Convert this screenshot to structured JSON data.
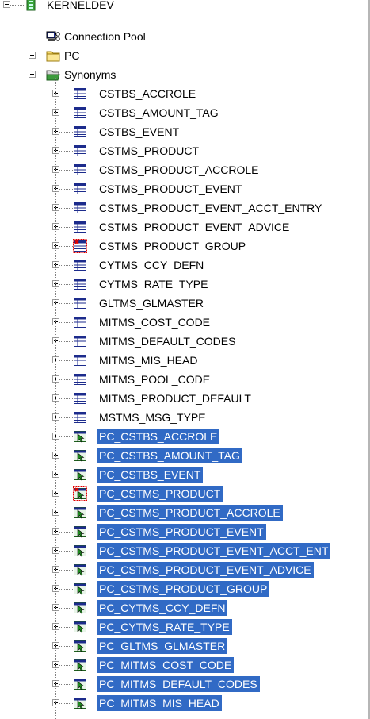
{
  "tree": {
    "root": {
      "label": "KERNELDEV",
      "icon": "database-icon",
      "expanded": true
    },
    "children": [
      {
        "label": "Connection Pool",
        "icon": "connection-pool-icon",
        "has_expander": false
      },
      {
        "label": "PC",
        "icon": "folder-icon",
        "has_expander": true,
        "expanded": false
      },
      {
        "label": "Synonyms",
        "icon": "folder-open-icon",
        "has_expander": true,
        "expanded": true
      }
    ],
    "synonyms": [
      {
        "label": "CSTBS_ACCROLE",
        "icon": "table-icon",
        "selected": false
      },
      {
        "label": "CSTBS_AMOUNT_TAG",
        "icon": "table-icon",
        "selected": false
      },
      {
        "label": "CSTBS_EVENT",
        "icon": "table-icon",
        "selected": false
      },
      {
        "label": "CSTMS_PRODUCT",
        "icon": "table-icon",
        "selected": false
      },
      {
        "label": "CSTMS_PRODUCT_ACCROLE",
        "icon": "table-icon",
        "selected": false
      },
      {
        "label": "CSTMS_PRODUCT_EVENT",
        "icon": "table-icon",
        "selected": false
      },
      {
        "label": "CSTMS_PRODUCT_EVENT_ACCT_ENTRY",
        "icon": "table-icon",
        "selected": false
      },
      {
        "label": "CSTMS_PRODUCT_EVENT_ADVICE",
        "icon": "table-icon",
        "selected": false
      },
      {
        "label": "CSTMS_PRODUCT_GROUP",
        "icon": "table-error-icon",
        "selected": false
      },
      {
        "label": "CYTMS_CCY_DEFN",
        "icon": "table-icon",
        "selected": false
      },
      {
        "label": "CYTMS_RATE_TYPE",
        "icon": "table-icon",
        "selected": false
      },
      {
        "label": "GLTMS_GLMASTER",
        "icon": "table-icon",
        "selected": false
      },
      {
        "label": "MITMS_COST_CODE",
        "icon": "table-icon",
        "selected": false
      },
      {
        "label": "MITMS_DEFAULT_CODES",
        "icon": "table-icon",
        "selected": false
      },
      {
        "label": "MITMS_MIS_HEAD",
        "icon": "table-icon",
        "selected": false
      },
      {
        "label": "MITMS_POOL_CODE",
        "icon": "table-icon",
        "selected": false
      },
      {
        "label": "MITMS_PRODUCT_DEFAULT",
        "icon": "table-icon",
        "selected": false
      },
      {
        "label": "MSTMS_MSG_TYPE",
        "icon": "table-icon",
        "selected": false
      },
      {
        "label": "PC_CSTBS_ACCROLE",
        "icon": "synonym-icon",
        "selected": true
      },
      {
        "label": "PC_CSTBS_AMOUNT_TAG",
        "icon": "synonym-icon",
        "selected": true
      },
      {
        "label": "PC_CSTBS_EVENT",
        "icon": "synonym-icon",
        "selected": true
      },
      {
        "label": "PC_CSTMS_PRODUCT",
        "icon": "synonym-error-icon",
        "selected": true
      },
      {
        "label": "PC_CSTMS_PRODUCT_ACCROLE",
        "icon": "synonym-icon",
        "selected": true
      },
      {
        "label": "PC_CSTMS_PRODUCT_EVENT",
        "icon": "synonym-icon",
        "selected": true
      },
      {
        "label": "PC_CSTMS_PRODUCT_EVENT_ACCT_ENT",
        "icon": "synonym-icon",
        "selected": true
      },
      {
        "label": "PC_CSTMS_PRODUCT_EVENT_ADVICE",
        "icon": "synonym-icon",
        "selected": true
      },
      {
        "label": "PC_CSTMS_PRODUCT_GROUP",
        "icon": "synonym-icon",
        "selected": true
      },
      {
        "label": "PC_CYTMS_CCY_DEFN",
        "icon": "synonym-icon",
        "selected": true
      },
      {
        "label": "PC_CYTMS_RATE_TYPE",
        "icon": "synonym-icon",
        "selected": true
      },
      {
        "label": "PC_GLTMS_GLMASTER",
        "icon": "synonym-icon",
        "selected": true
      },
      {
        "label": "PC_MITMS_COST_CODE",
        "icon": "synonym-icon",
        "selected": true
      },
      {
        "label": "PC_MITMS_DEFAULT_CODES",
        "icon": "synonym-icon",
        "selected": true
      },
      {
        "label": "PC_MITMS_MIS_HEAD",
        "icon": "synonym-icon",
        "selected": true
      }
    ]
  },
  "colors": {
    "selection": "#316ac5",
    "selection_text": "#ffffff",
    "tree_lines": "#808080"
  }
}
